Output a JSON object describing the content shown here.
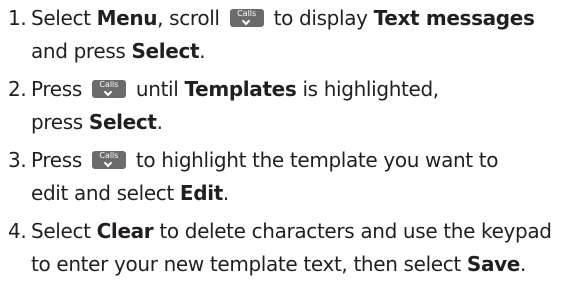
{
  "key_icon": {
    "label": "Calls",
    "name": "calls-down-key-icon",
    "color": "#6b6b6b"
  },
  "steps": [
    {
      "number": "1.",
      "line1": {
        "t1": "Select ",
        "b1": "Menu",
        "t2": ", scroll ",
        "t3": " to display ",
        "b2": "Text messages"
      },
      "line2": {
        "t1": "and press ",
        "b1": "Select",
        "t2": "."
      }
    },
    {
      "number": "2.",
      "line1": {
        "t1": "Press ",
        "t2": " until ",
        "b1": "Templates",
        "t3": " is highlighted,"
      },
      "line2": {
        "t1": "press ",
        "b1": "Select",
        "t2": "."
      }
    },
    {
      "number": "3.",
      "line1": {
        "t1": "Press ",
        "t2": " to highlight the template you want to"
      },
      "line2": {
        "t1": "edit and select ",
        "b1": "Edit",
        "t2": "."
      }
    },
    {
      "number": "4.",
      "line1": {
        "t1": "Select ",
        "b1": "Clear",
        "t2": " to delete characters and use the keypad"
      },
      "line2": {
        "t1": "to enter your new template text, then select ",
        "b1": "Save",
        "t2": "."
      }
    }
  ]
}
